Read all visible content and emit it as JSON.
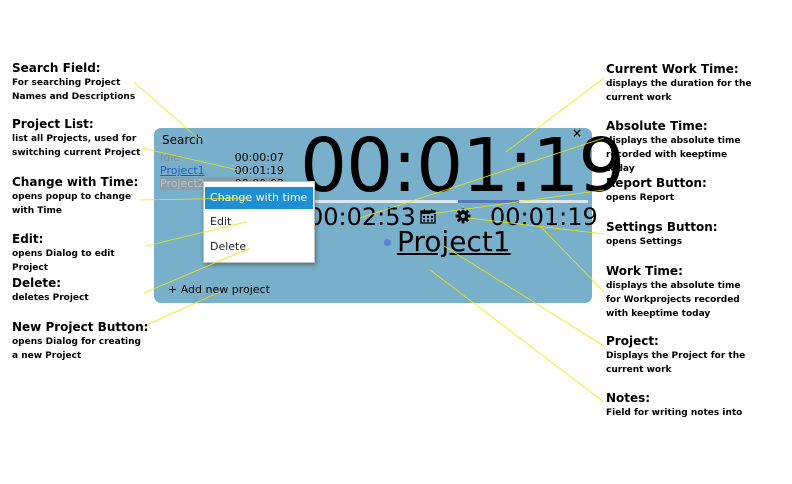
{
  "widget": {
    "search_label": "Search",
    "projects": [
      {
        "name": "Idle",
        "time": "00:00:07"
      },
      {
        "name": "Project1",
        "time": "00:01:19"
      },
      {
        "name": "Project2",
        "time": "00:00:03"
      }
    ],
    "current_work_time": "00:01:19",
    "absolute_time": "00:02:53",
    "workproject_time": "00:01:19",
    "project_title": "Project1",
    "add_project_label": "+ Add new project",
    "minimize_label": "_",
    "close_label": "×",
    "work_progress": 0.47
  },
  "context_menu": {
    "items": [
      "Change with time",
      "Edit",
      "Delete"
    ]
  },
  "annotations": {
    "search_field": {
      "title": "Search Field:",
      "desc": "For searching Project Names and Descriptions"
    },
    "project_list": {
      "title": "Project List:",
      "desc": "list all Projects, used for switching current Project"
    },
    "change_with_time": {
      "title": "Change with Time:",
      "desc": "opens popup to change with Time"
    },
    "edit": {
      "title": "Edit:",
      "desc": "opens Dialog to edit Project"
    },
    "delete": {
      "title": "Delete:",
      "desc": "deletes Project"
    },
    "new_project_button": {
      "title": "New Project Button:",
      "desc": "opens Dialog for creating a new Project"
    },
    "current_work_time": {
      "title": "Current Work Time:",
      "desc": "displays the duration for the current work"
    },
    "absolute_time": {
      "title": "Absolute Time:",
      "desc": "displays the absolute time recorded with keeptime today"
    },
    "report_button": {
      "title": "Report Button:",
      "desc": "opens Report"
    },
    "settings_button": {
      "title": "Settings Button:",
      "desc": "opens Settings"
    },
    "work_time": {
      "title": "Work Time:",
      "desc": "displays the absolute time for Workprojects recorded with keeptime today"
    },
    "project": {
      "title": "Project:",
      "desc": "Displays the Project for the current work"
    },
    "notes": {
      "title": "Notes:",
      "desc": "Field for writing notes into"
    }
  },
  "colors": {
    "widget_bg": "#78b0cb",
    "menu_highlight": "#1f8fd3",
    "leader_line": "#f2e600",
    "project_link": "#2a5db0",
    "accent_bar": "#5a78b8"
  },
  "icons": {
    "report": "calendar-icon",
    "settings": "gear-icon"
  }
}
